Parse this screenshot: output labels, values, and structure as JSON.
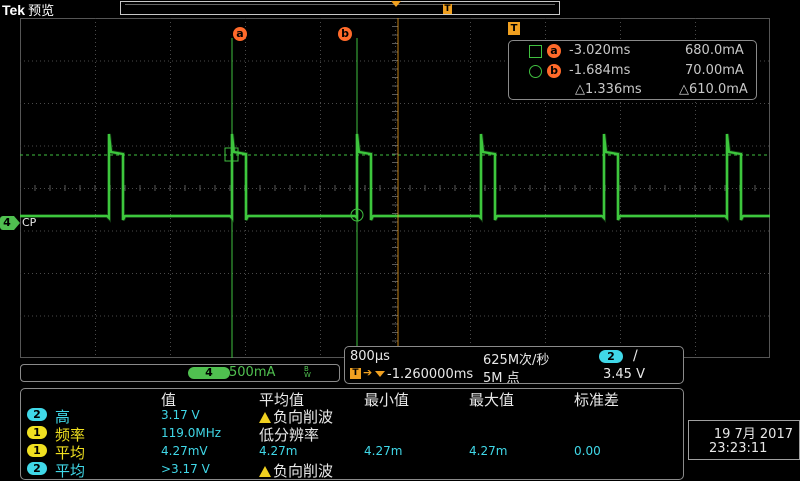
{
  "header": {
    "brand": "Tek",
    "mode": "预览",
    "trigger_marker": "T"
  },
  "waveform": {
    "channel_label": "4",
    "channel_name": "CP",
    "trace_color": "#40d040",
    "cursor_a_label": "a",
    "cursor_b_label": "b",
    "trigger_level_label": "T"
  },
  "cursors": {
    "a_time": "-3.020ms",
    "a_value": "680.0mA",
    "b_time": "-1.684ms",
    "b_value": "70.00mA",
    "delta_time": "△1.336ms",
    "delta_value": "△610.0mA",
    "a_letter": "a",
    "b_letter": "b"
  },
  "vertical": {
    "channel": "4",
    "scale": "500mA",
    "bw": "B\nW"
  },
  "horizontal": {
    "timebase": "800µs",
    "sample_rate": "625M次/秒",
    "trig_channel": "2",
    "trig_slope": "/",
    "trig_offset": "-1.260000ms",
    "record_length": "5M 点",
    "trig_level": "3.45 V"
  },
  "measurements": {
    "headers": [
      "值",
      "平均值",
      "最小值",
      "最大值",
      "标准差"
    ],
    "rows": [
      {
        "ch": "2",
        "ch_color": "#40d8e8",
        "name": "高",
        "value": "3.17 V",
        "mean": "负向削波",
        "mean_warn": true,
        "min": "",
        "max": "",
        "std": ""
      },
      {
        "ch": "1",
        "ch_color": "#f0e020",
        "name": "频率",
        "value": "119.0MHz",
        "mean": "低分辨率",
        "mean_warn": false,
        "min": "",
        "max": "",
        "std": ""
      },
      {
        "ch": "1",
        "ch_color": "#f0e020",
        "name": "平均",
        "value": "4.27mV",
        "mean": "4.27m",
        "mean_warn": false,
        "min": "4.27m",
        "max": "4.27m",
        "std": "0.00"
      },
      {
        "ch": "2",
        "ch_color": "#40d8e8",
        "name": "平均",
        "value": ">3.17 V",
        "mean": "负向削波",
        "mean_warn": true,
        "min": "",
        "max": "",
        "std": ""
      }
    ]
  },
  "datetime": {
    "date": "19 7月 2017",
    "time": "23:23:11"
  }
}
